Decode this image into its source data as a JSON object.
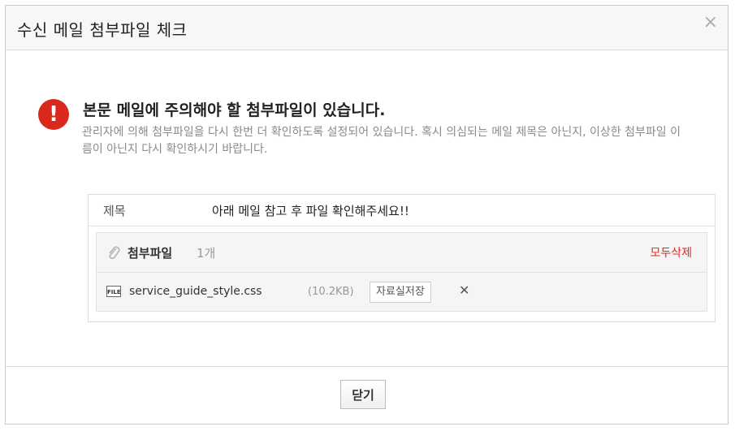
{
  "dialog": {
    "title": "수신 메일 첨부파일 체크",
    "close_icon": "×"
  },
  "warning": {
    "icon": "!",
    "headline": "본문 메일에 주의해야 할 첨부파일이 있습니다.",
    "description": "관리자에 의해 첨부파일을 다시 한번 더 확인하도록 설정되어 있습니다. 혹시 의심되는 메일 제목은 아닌지, 이상한 첨부파일 이름이 아닌지 다시 확인하시기 바랍니다."
  },
  "subject": {
    "label": "제목",
    "value": "아래 메일 참고 후 파일 확인해주세요!!"
  },
  "attachments": {
    "title": "첨부파일",
    "count": "1개",
    "delete_all": "모두삭제",
    "files": [
      {
        "icon": "FILE",
        "name": "service_guide_style.css",
        "size": "(10.2KB)",
        "save_label": "자료실저장",
        "remove": "✕"
      }
    ]
  },
  "footer": {
    "close_label": "닫기"
  },
  "colors": {
    "warning_red": "#d9281c",
    "delete_red": "#d9281c"
  }
}
